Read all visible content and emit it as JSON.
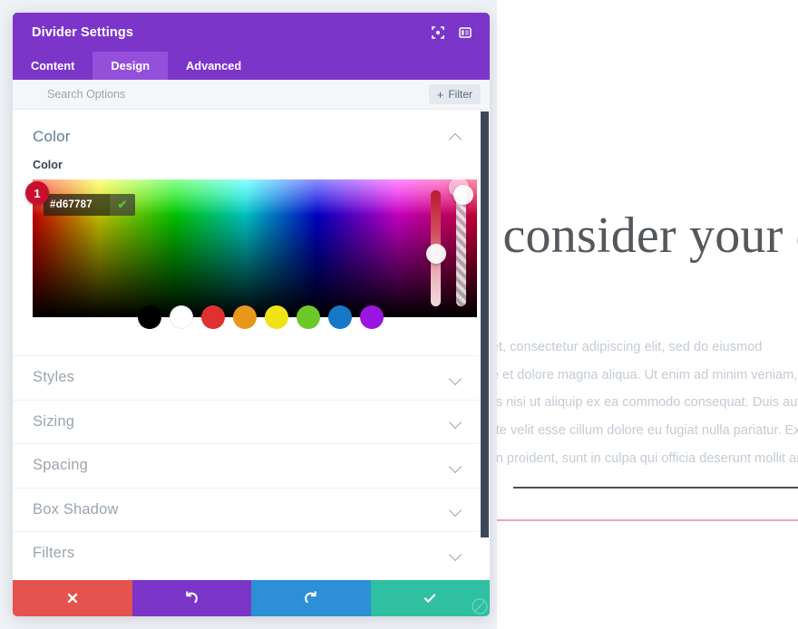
{
  "background": {
    "page_bg": "#eef1f6",
    "content_bg": "#ffffff"
  },
  "page": {
    "heading": "Always consider your divider first",
    "paragraph_lines": [
      "Lorem ipsum dolor sit amet, consectetur adipiscing elit, sed do eiusmod",
      "tempor incididunt ut labore et dolore magna aliqua. Ut enim ad minim veniam, quis nostrud",
      "exercitation ullamco laboris nisi ut aliquip ex ea commodo consequat. Duis aute irure dolor",
      "in reprehenderit in voluptate velit esse cillum dolore eu fugiat nulla pariatur. Excepteur",
      "sint occaecat cupidatat non proident, sunt in culpa qui officia deserunt mollit anim id est laborum."
    ],
    "divider_dark_color": "#4c5055",
    "divider_pink_color": "#d67787"
  },
  "modal": {
    "title": "Divider Settings",
    "header_icons": [
      {
        "name": "focus-target-icon",
        "glyph": "focus"
      },
      {
        "name": "panel-layout-icon",
        "glyph": "panel"
      }
    ],
    "tabs": [
      {
        "label": "Content",
        "active": false
      },
      {
        "label": "Design",
        "active": true
      },
      {
        "label": "Advanced",
        "active": false
      }
    ],
    "search": {
      "placeholder": "Search Options",
      "value": ""
    },
    "filter_button": {
      "plus": "+",
      "label": "Filter"
    },
    "color_section": {
      "title": "Color",
      "expanded": true,
      "field_label": "Color",
      "hex_value": "#d67787",
      "hex_confirm_glyph": "✔",
      "step_badge": "1",
      "hue_slider_position_pct": 55,
      "alpha_slider_position_pct": 4,
      "swatches": [
        {
          "name": "swatch-black",
          "color": "#000000"
        },
        {
          "name": "swatch-white",
          "color": "#ffffff"
        },
        {
          "name": "swatch-red",
          "color": "#e03131"
        },
        {
          "name": "swatch-orange",
          "color": "#e8971b"
        },
        {
          "name": "swatch-yellow",
          "color": "#efe215"
        },
        {
          "name": "swatch-green",
          "color": "#6dc82a"
        },
        {
          "name": "swatch-blue",
          "color": "#1878c8"
        },
        {
          "name": "swatch-purple",
          "color": "#9b16e0"
        }
      ]
    },
    "accordion_sections": [
      {
        "label": "Styles"
      },
      {
        "label": "Sizing"
      },
      {
        "label": "Spacing"
      },
      {
        "label": "Box Shadow"
      },
      {
        "label": "Filters"
      }
    ],
    "footer_buttons": [
      {
        "name": "cancel-button",
        "glyph": "✖",
        "color": "#e5534e"
      },
      {
        "name": "undo-button",
        "glyph": "↺",
        "color": "#7b36c9"
      },
      {
        "name": "redo-button",
        "glyph": "↻",
        "color": "#2d8fd5"
      },
      {
        "name": "save-button",
        "glyph": "✔",
        "color": "#2ec0a0"
      }
    ]
  }
}
